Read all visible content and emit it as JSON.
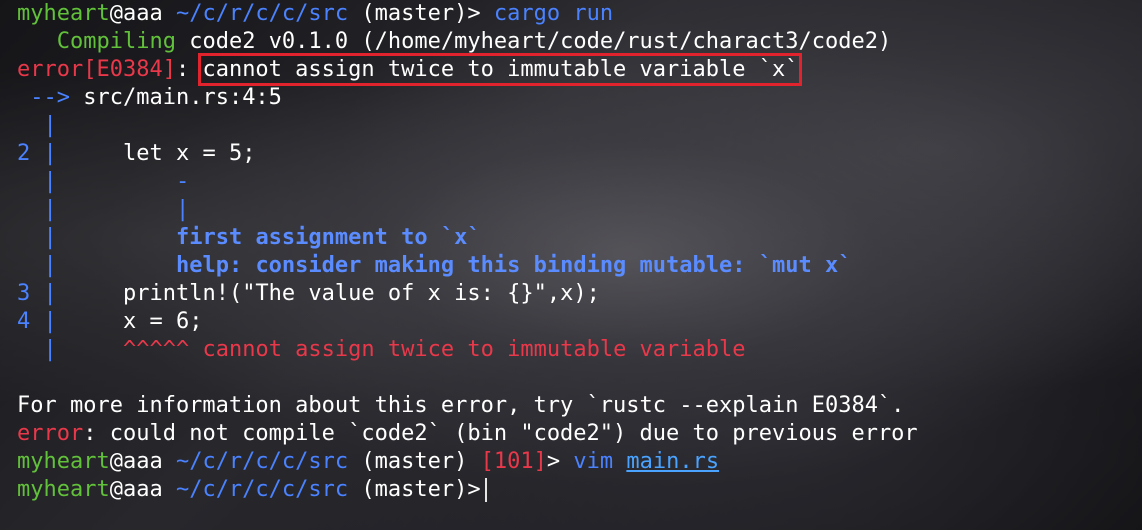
{
  "prompt": {
    "user": "myheart",
    "host_sep": "@aaa",
    "path": "~/c/r/c/c/src",
    "branch": "(master)",
    "symbol": ">"
  },
  "cmd1": {
    "program": "cargo",
    "arg": "run"
  },
  "compiling": {
    "label": "Compiling",
    "text": "code2 v0.1.0 (/home/myheart/code/rust/charact3/code2)"
  },
  "error1": {
    "code": "error[E0384]",
    "colon": ":",
    "message": "cannot assign twice to immutable variable `x`"
  },
  "location": {
    "arrow": "-->",
    "path": "src/main.rs:4:5"
  },
  "gutter": {
    "bar": "|",
    "line2": "2",
    "line3": "3",
    "line4": "4"
  },
  "code": {
    "line2": "let x = 5;",
    "underscore": "-",
    "pipe": "|",
    "first_assignment": "first assignment to `x`",
    "help": "help: consider making this binding mutable: `mut x`",
    "line3": "println!(\"The value of x is: {}\",x);",
    "line4": "x = 6;",
    "carets": "^^^^^",
    "caret_message": "cannot assign twice to immutable variable"
  },
  "more_info": "For more information about this error, try `rustc --explain E0384`.",
  "error2": {
    "label": "error",
    "text": ": could not compile `code2` (bin \"code2\") due to previous error"
  },
  "exit_code": "[101]",
  "cmd2": {
    "program": "vim",
    "arg": "main.rs"
  },
  "colors": {
    "green": "#62c13a",
    "blue": "#4a82ff",
    "red": "#e8384a",
    "highlight_box": "#e1232e"
  }
}
